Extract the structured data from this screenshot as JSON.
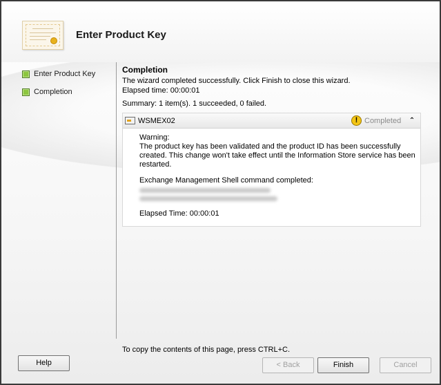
{
  "window": {
    "header_title": "Enter Product Key",
    "header_icon": "certificate-icon"
  },
  "nav": {
    "items": [
      {
        "label": "Enter Product Key",
        "icon": "green-square-bullet"
      },
      {
        "label": "Completion",
        "icon": "green-square-bullet"
      }
    ]
  },
  "completion": {
    "title": "Completion",
    "message": "The wizard completed successfully. Click Finish to close this wizard.",
    "elapsed": "Elapsed time: 00:00:01",
    "summary": "Summary: 1 item(s). 1 succeeded, 0 failed."
  },
  "result": {
    "server_name": "WSMEX02",
    "status": "Completed",
    "warning_label": "Warning:",
    "warning_text": "The product key has been validated and the product ID has been successfully created. This change won't take effect until the Information Store service has been restarted.",
    "command_label": "Exchange Management Shell command completed:",
    "elapsed_time": "Elapsed Time: 00:00:01"
  },
  "footer": {
    "copy_hint": "To copy the contents of this page, press CTRL+C."
  },
  "buttons": {
    "help": "Help",
    "back": "< Back",
    "finish": "Finish",
    "cancel": "Cancel"
  },
  "colors": {
    "bullet_green": "#8cc63f",
    "warning_yellow": "#f3c515",
    "status_gray": "#8a8a8a"
  }
}
